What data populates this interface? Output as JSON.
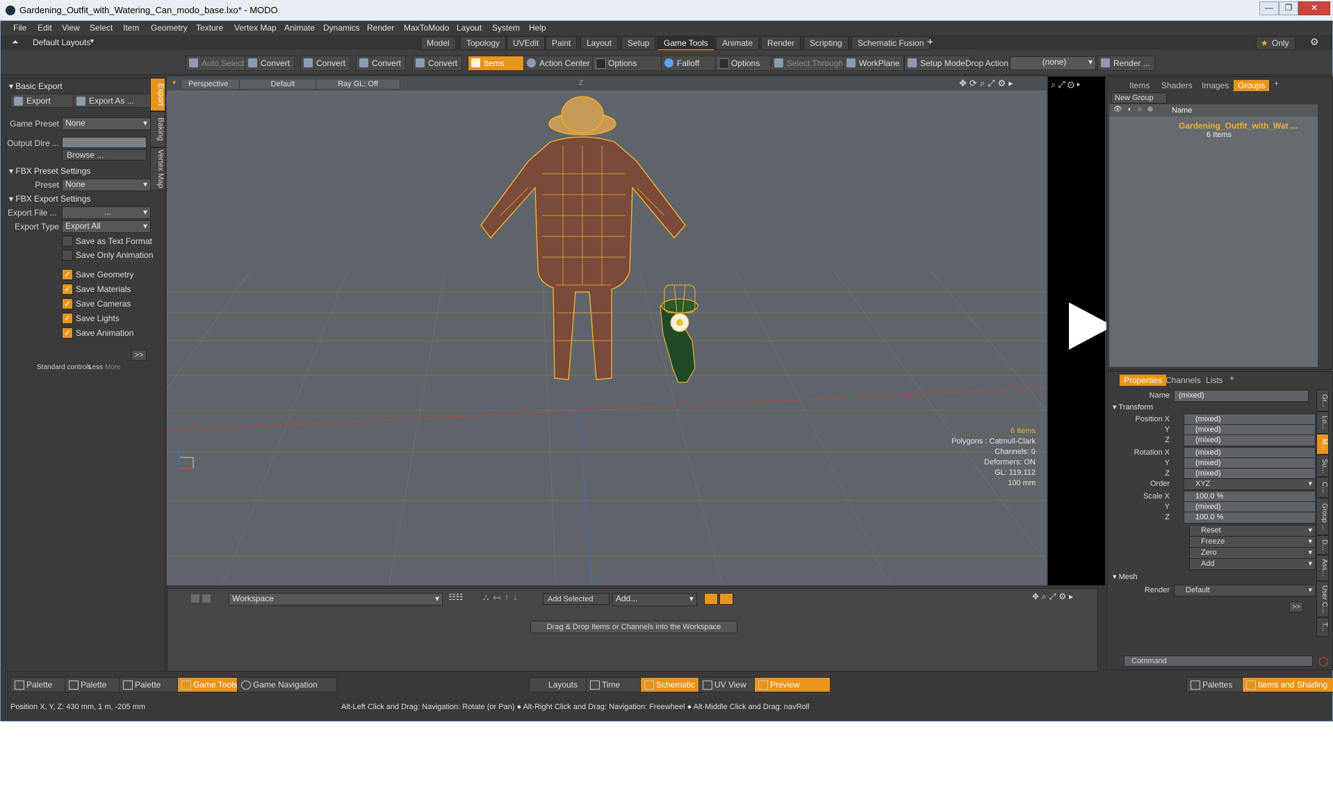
{
  "window": {
    "title": "Gardening_Outfit_with_Watering_Can_modo_base.lxo* - MODO",
    "controls": {
      "minimize": "—",
      "maximize": "❐",
      "close": "✕"
    }
  },
  "menu": [
    "File",
    "Edit",
    "View",
    "Select",
    "Item",
    "Geometry",
    "Texture",
    "Vertex Map",
    "Animate",
    "Dynamics",
    "Render",
    "MaxToModo",
    "Layout",
    "System",
    "Help"
  ],
  "layouts": {
    "selector": "Default Layouts",
    "tabs": [
      "Model",
      "Topology",
      "UVEdit",
      "Paint",
      "Layout",
      "Setup",
      "Game Tools",
      "Animate",
      "Render",
      "Scripting",
      "Schematic Fusion"
    ],
    "active": "Game Tools",
    "add": "+",
    "only": "Only"
  },
  "toolbar": {
    "auto_select": "Auto Select",
    "convert1": "Convert",
    "convert2": "Convert",
    "convert3": "Convert",
    "convert4": "Convert",
    "items": "Items",
    "action_center": "Action Center",
    "options1": "Options",
    "falloff": "Falloff",
    "options2": "Options",
    "select_through": "Select Through",
    "workplane": "WorkPlane",
    "setup_mode": "Setup Mode",
    "drop_action_label": "Drop Action",
    "drop_action_value": "(none)",
    "render": "Render ..."
  },
  "left": {
    "side_tabs": [
      "Export",
      "Baking",
      "Vertex Map"
    ],
    "basic_export": "Basic Export",
    "export_btn": "Export",
    "export_as_btn": "Export As ...",
    "game_preset_label": "Game Preset",
    "game_preset_value": "None",
    "output_dir_label": "Output Dire ...",
    "browse": "Browse ...",
    "fbx_preset_settings": "FBX Preset Settings",
    "preset_label": "Preset",
    "preset_value": "None",
    "fbx_export_settings": "FBX Export Settings",
    "export_file_label": "Export File ...",
    "export_file_value": "...",
    "export_type_label": "Export Type",
    "export_type_value": "Export All",
    "checkboxes": [
      {
        "label": "Save as Text Format",
        "checked": false
      },
      {
        "label": "Save Only Animation",
        "checked": false
      },
      {
        "label": "Save Geometry",
        "checked": true
      },
      {
        "label": "Save Materials",
        "checked": true
      },
      {
        "label": "Save Cameras",
        "checked": true
      },
      {
        "label": "Save Lights",
        "checked": true
      },
      {
        "label": "Save Animation",
        "checked": true
      }
    ],
    "more_btn": ">>",
    "standard_controls": "Standard controls",
    "less": "Less",
    "more": "More"
  },
  "viewport": {
    "perspective": "Perspective",
    "default": "Default",
    "raygl": "Ray GL: Off",
    "axis_label": "Z",
    "stats": {
      "items": "6 Items",
      "polygons": "Polygons : Catmull-Clark",
      "channels": "Channels: 0",
      "deformers": "Deformers: ON",
      "gl": "GL: 119,112",
      "scale": "100 mm"
    }
  },
  "groups_panel": {
    "tabs": [
      "Items",
      "Shaders",
      "Images",
      "Groups"
    ],
    "active": "Groups",
    "new_group": "New Group",
    "col_name": "Name",
    "group_name": "Gardening_Outfit_with_Wat ...",
    "group_count": "6 Items"
  },
  "properties": {
    "tabs": [
      "Properties",
      "Channels",
      "Lists"
    ],
    "active": "Properties",
    "name_label": "Name",
    "name_value": "(mixed)",
    "transform": "Transform",
    "position": {
      "label": "Position X",
      "x": "(mixed)",
      "y": "(mixed)",
      "z": "(mixed)"
    },
    "rotation": {
      "label": "Rotation X",
      "x": "(mixed)",
      "y": "(mixed)",
      "z": "(mixed)"
    },
    "order_label": "Order",
    "order_value": "XYZ",
    "scale": {
      "label": "Scale X",
      "x": "100.0 %",
      "y": "(mixed)",
      "z": "100.0 %"
    },
    "y_label": "Y",
    "z_label": "Z",
    "actions": [
      "Reset",
      "Freeze",
      "Zero",
      "Add"
    ],
    "mesh": "Mesh",
    "render_label": "Render",
    "render_value": "Default",
    "more": ">>",
    "command_placeholder": "Command",
    "side_tabs": [
      "Gr...",
      "Lo...",
      "M...",
      "Su...",
      "C...",
      "Group ...",
      "D...",
      "Ass...",
      "User C...",
      "T..."
    ]
  },
  "workspace": {
    "dropdown": "Workspace",
    "add_selected": "Add Selected",
    "add": "Add...",
    "hint": "Drag & Drop Items or Channels into the Workspace"
  },
  "bottom": {
    "tabs_left": [
      "Palette",
      "Palette",
      "Palette",
      "Game Tools",
      "Game Navigation"
    ],
    "tabs_center": [
      "Layouts",
      "Time",
      "Schematic",
      "UV View",
      "Preview"
    ],
    "tabs_right": [
      "Palettes",
      "Items and Shading"
    ]
  },
  "status": {
    "position": "Position X, Y, Z:  430 mm, 1 m, -205 mm",
    "hint": "Alt-Left Click and Drag: Navigation: Rotate (or Pan) ● Alt-Right Click and Drag: Navigation: Freewheel ● Alt-Middle Click and Drag: navRoll"
  },
  "colors": {
    "accent": "#e8951c",
    "wire": "#f2b02e",
    "bg": "#3a3a3a",
    "viewport": "#5f656a"
  }
}
